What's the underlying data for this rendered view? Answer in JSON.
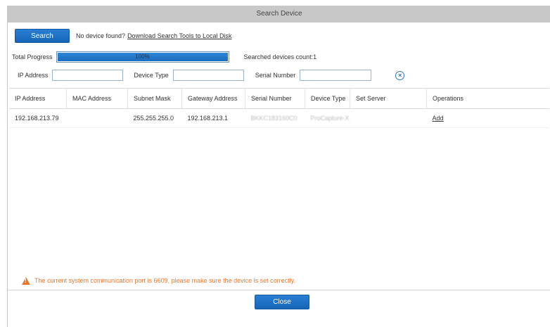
{
  "dialog": {
    "title": "Search Device",
    "search_label": "Search",
    "no_device_text": "No device found?",
    "download_link": "Download Search Tools to Local Disk",
    "total_progress_label": "Total Progress",
    "progress_text": "100%",
    "progress_value": 1.0,
    "searched_count_text": "Searched devices count:1",
    "filters": {
      "ip_label": "IP Address",
      "ip_value": "",
      "type_label": "Device Type",
      "type_value": "",
      "serial_label": "Serial Number",
      "serial_value": ""
    },
    "clear_icon": "clear-circle-x-icon",
    "table": {
      "headers": [
        "IP Address",
        "MAC Address",
        "Subnet Mask",
        "Gateway Address",
        "Serial Number",
        "Device Type",
        "Set Server",
        "Operations"
      ],
      "rows": [
        {
          "ip": "192.168.213.79",
          "mac": "",
          "subnet": "255.255.255.0",
          "gateway": "192.168.213.1",
          "serial": "BKKC183160C0",
          "device_type": "ProCapture-X",
          "set_server": "",
          "operation": "Add"
        }
      ]
    },
    "warning_text": "The current system communication port is 6609, please make sure the device is set correctly.",
    "close_label": "Close"
  },
  "colors": {
    "accent": "#1a6bbf",
    "warning": "#e8772e",
    "titlebar": "#c8c8c8"
  }
}
